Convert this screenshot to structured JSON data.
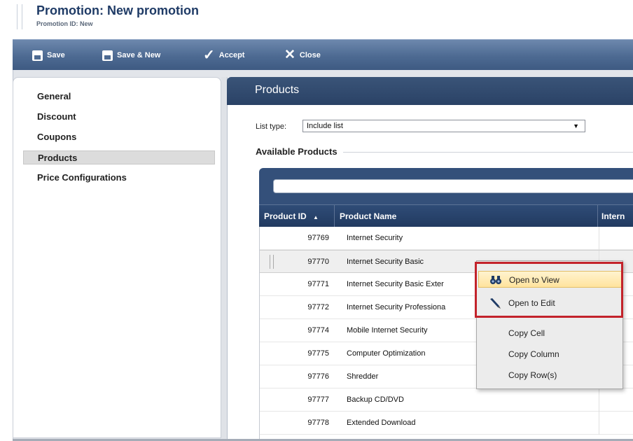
{
  "header": {
    "title": "Promotion: New promotion",
    "subtitle": "Promotion ID:  New"
  },
  "toolbar": {
    "save": "Save",
    "save_new": "Save & New",
    "accept": "Accept",
    "close": "Close"
  },
  "nav": {
    "items": [
      "General",
      "Discount",
      "Coupons",
      "Products",
      "Price Configurations"
    ],
    "selected": "Products"
  },
  "products": {
    "title": "Products",
    "list_type_label": "List type:",
    "list_type_value": "Include list",
    "available_label": "Available Products"
  },
  "grid": {
    "columns": [
      "Product ID",
      "Product Name",
      "Intern"
    ],
    "rows": [
      {
        "id": "97769",
        "name": "Internet Security"
      },
      {
        "id": "97770",
        "name": "Internet Security Basic"
      },
      {
        "id": "97771",
        "name": "Internet Security Basic Exter"
      },
      {
        "id": "97772",
        "name": "Internet Security Professiona"
      },
      {
        "id": "97774",
        "name": "Mobile Internet Security"
      },
      {
        "id": "97775",
        "name": "Computer Optimization"
      },
      {
        "id": "97776",
        "name": "Shredder"
      },
      {
        "id": "97777",
        "name": "Backup CD/DVD"
      },
      {
        "id": "97778",
        "name": "Extended Download"
      }
    ]
  },
  "context_menu": {
    "items": [
      {
        "label": "Open to View",
        "icon": "binoculars-icon"
      },
      {
        "label": "Open to Edit",
        "icon": "pencil-icon"
      },
      {
        "label": "Copy Cell",
        "icon": ""
      },
      {
        "label": "Copy Column",
        "icon": ""
      },
      {
        "label": "Copy Row(s)",
        "icon": ""
      }
    ]
  },
  "colors": {
    "toolbar": "#4d6a92",
    "header": "#2a4266",
    "highlight": "#c3232b"
  }
}
